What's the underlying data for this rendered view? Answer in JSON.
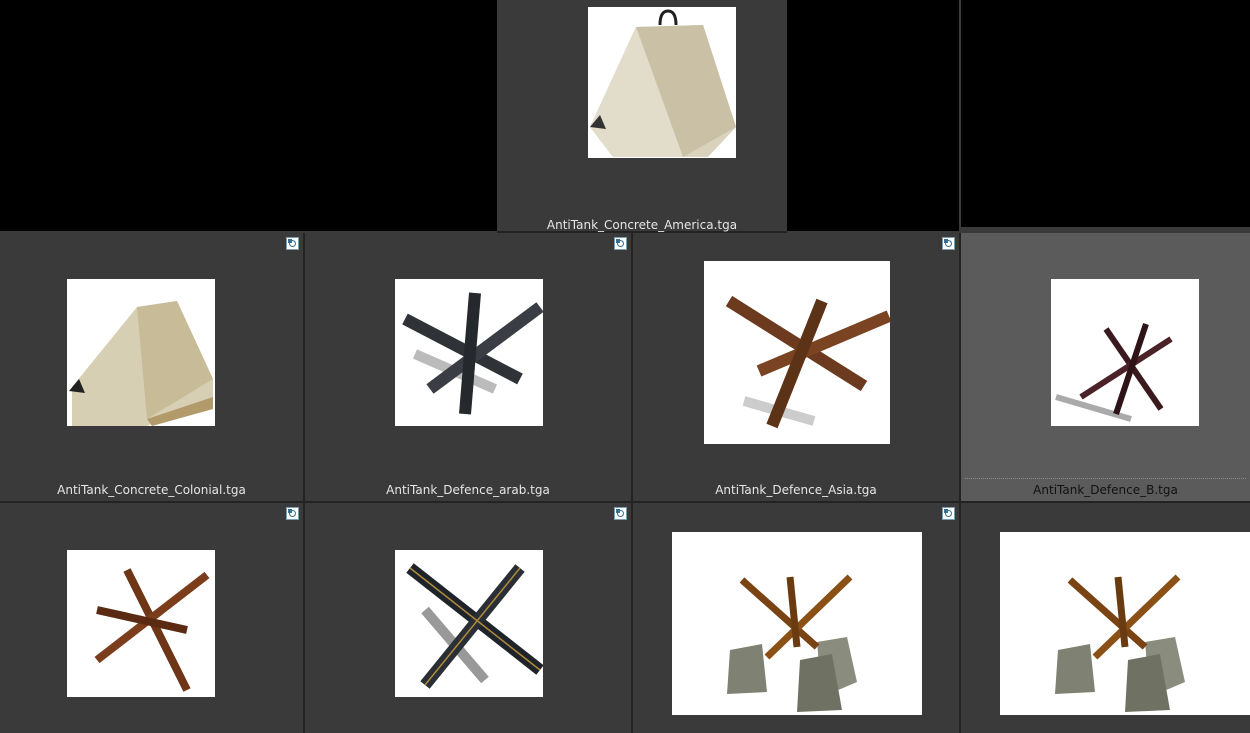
{
  "files": [
    {
      "name": "AntiTank_Concrete_America.tga",
      "icon": "concrete-pyramid-with-ring-icon"
    },
    {
      "name": "AntiTank_Concrete_Colonial.tga",
      "icon": "concrete-block-icon"
    },
    {
      "name": "AntiTank_Defence_arab.tga",
      "icon": "steel-hedgehog-dark-icon"
    },
    {
      "name": "AntiTank_Defence_Asia.tga",
      "icon": "rusty-hedgehog-icon"
    },
    {
      "name": "AntiTank_Defence_B.tga",
      "icon": "thin-hedgehog-icon",
      "selected": true
    },
    {
      "name": "",
      "icon": "rusty-hedgehog-icon"
    },
    {
      "name": "",
      "icon": "hedgehog-gold-edges-icon"
    },
    {
      "name": "",
      "icon": "hedgehog-on-concrete-icon"
    },
    {
      "name": "",
      "icon": "hedgehog-on-concrete-icon"
    }
  ],
  "colors": {
    "background": "#3a3a3a",
    "selected": "#5b5b5b",
    "label": "#e6e6e6",
    "thumb_bg": "#ffffff"
  }
}
